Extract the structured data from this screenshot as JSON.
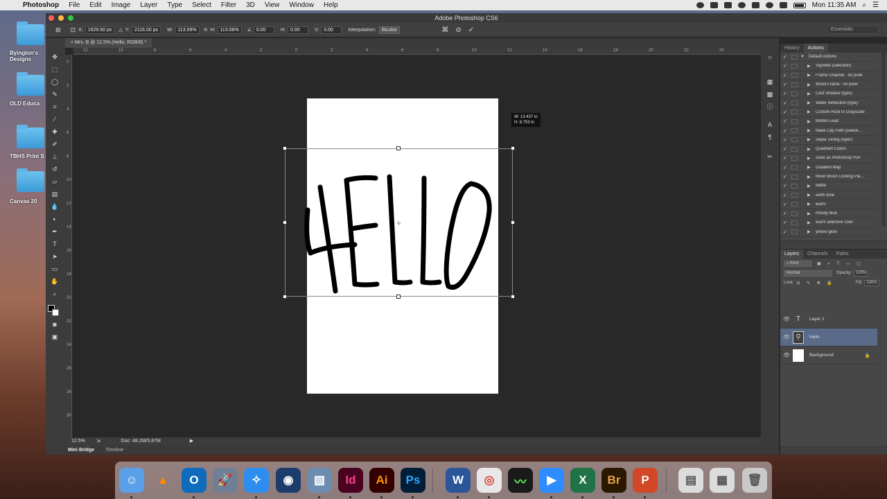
{
  "menubar": {
    "items": [
      "Photoshop",
      "File",
      "Edit",
      "Image",
      "Layer",
      "Type",
      "Select",
      "Filter",
      "3D",
      "View",
      "Window",
      "Help"
    ],
    "clock": "Mon 11:35 AM"
  },
  "desktop": {
    "icons": [
      "Byington's Designs",
      "OLD Educa",
      "TBHS Print S",
      "Canvas 20"
    ]
  },
  "window": {
    "title": "Adobe Photoshop CS6",
    "workspace": "Essentials"
  },
  "options": {
    "x_label": "X:",
    "x_value": "1629.50 px",
    "y_label": "Y:",
    "y_value": "2116.00 px",
    "w_label": "W:",
    "w_value": "113.59%",
    "h_label": "H:",
    "h_value": "113.56%",
    "angle_value": "0.00",
    "hskew_label": "H:",
    "hskew_value": "0.00",
    "vskew_label": "V:",
    "vskew_value": "0.00",
    "interp_label": "Interpolation:",
    "interp_value": "Bicubic"
  },
  "document": {
    "tab_title": "Mrs. B @ 12.5% (Hello, RGB/8) *",
    "zoom": "12.5%",
    "doc_info": "Doc: 48.2M/5.87M",
    "dim_tooltip_w": "W: 13.437 in",
    "dim_tooltip_h": "H:   8.753 in"
  },
  "ruler": {
    "h_ticks": [
      "12",
      "10",
      "8",
      "6",
      "4",
      "2",
      "0",
      "2",
      "4",
      "6",
      "8",
      "10",
      "12",
      "14",
      "16",
      "18",
      "20",
      "22",
      "24"
    ],
    "v_ticks": [
      "0",
      "2",
      "4",
      "6",
      "8",
      "10",
      "12",
      "14",
      "16",
      "18",
      "20",
      "22",
      "24",
      "26",
      "28",
      "30"
    ]
  },
  "bottom_tabs": [
    "Mini Bridge",
    "Timeline"
  ],
  "actions_panel": {
    "tabs": [
      "History",
      "Actions"
    ],
    "set_name": "Default Actions",
    "items": [
      "Vignette (selection)",
      "Frame Channel - 50 pixel",
      "Wood Frame - 50 pixel",
      "Cast Shadow (type)",
      "Water Reflection (type)",
      "Custom RGB to Grayscale",
      "Molten Lead",
      "Make Clip Path (selecti...",
      "Sepia Toning (layer)",
      "Quadrant Colors",
      "Save as Photoshop PDF",
      "Gradient Map",
      "Mixer Brush Cloning Pai...",
      "Matte",
      "earth tone",
      "warm",
      "moody blue",
      "warm selective color",
      "yellow glow"
    ]
  },
  "layers_panel": {
    "tabs": [
      "Layers",
      "Channels",
      "Paths"
    ],
    "kind_label": "Kind",
    "blend_mode": "Normal",
    "opacity_label": "Opacity:",
    "opacity_value": "100%",
    "lock_label": "Lock:",
    "fill_label": "Fill:",
    "fill_value": "100%",
    "layers": [
      {
        "name": "Layer 1",
        "kind": "type"
      },
      {
        "name": "Hello",
        "kind": "smart"
      },
      {
        "name": "Background",
        "kind": "bg"
      }
    ]
  },
  "dock": {
    "apps": [
      "finder-icon",
      "vlc-icon",
      "outlook-icon",
      "launchpad-icon",
      "safari-icon",
      "screenflow-icon",
      "preview-icon",
      "indesign-icon",
      "illustrator-icon",
      "photoshop-icon",
      "word-icon",
      "chrome-icon",
      "activity-monitor-icon",
      "zoom-icon",
      "excel-icon",
      "bridge-icon",
      "powerpoint-icon",
      "documents-icon",
      "downloads-icon",
      "trash-icon"
    ],
    "letters": {
      "indesign": "Id",
      "illustrator": "Ai",
      "photoshop": "Ps",
      "word": "W",
      "excel": "X",
      "bridge": "Br",
      "powerpoint": "P",
      "outlook": "O"
    }
  }
}
